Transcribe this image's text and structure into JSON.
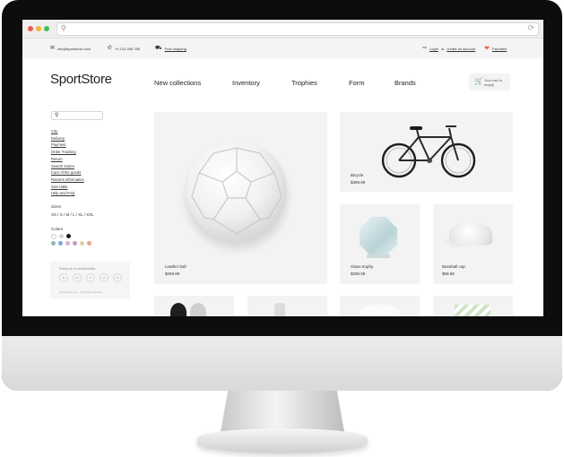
{
  "browser": {
    "address": ""
  },
  "infobar": {
    "email": "info@sportstore.com",
    "phone": "+0 123 456 789",
    "shipping": "Free shipping",
    "login": "Login",
    "or": "or",
    "create_account": "create an account",
    "favorites": "Favorites"
  },
  "header": {
    "logo": "SportStore",
    "nav": [
      "New collections",
      "Inventory",
      "Trophies",
      "Form",
      "Brands"
    ],
    "cart": "Your cart is empty"
  },
  "sidebar": {
    "links": [
      "City",
      "Delivery",
      "Payment",
      "Order Tracking",
      "Return",
      "Search stores",
      "Care of the goods",
      "Returns Information",
      "Size table",
      "Help and FAQ"
    ],
    "sizes_heading": "Sizes",
    "sizes": "XS / S / M / L / XL / XXL",
    "colors_heading": "Colors",
    "color_row1": [
      "#ffffff",
      "#d8d8d8",
      "#1a1a1a"
    ],
    "color_row2": [
      "#8fb8b0",
      "#7ea7cf",
      "#d6b0d0",
      "#c79ac7",
      "#d9d0a8",
      "#f0a08c"
    ],
    "promo_title": "Follow us on social media",
    "promo_social": [
      "fb",
      "tw",
      "in",
      "yt",
      "vk"
    ],
    "promo_copy": "SportStore.com · All rights reserved"
  },
  "products": [
    {
      "name": "Leather ball",
      "price": "$299.99"
    },
    {
      "name": "Bicycle",
      "price": "$399.99"
    },
    {
      "name": "Glass trophy",
      "price": "$299.99"
    },
    {
      "name": "Baseball cap",
      "price": "$59.99"
    }
  ],
  "colors": {
    "frame": "#0d0d0d",
    "card": "#f3f3f3",
    "accent": "#f0643c"
  }
}
